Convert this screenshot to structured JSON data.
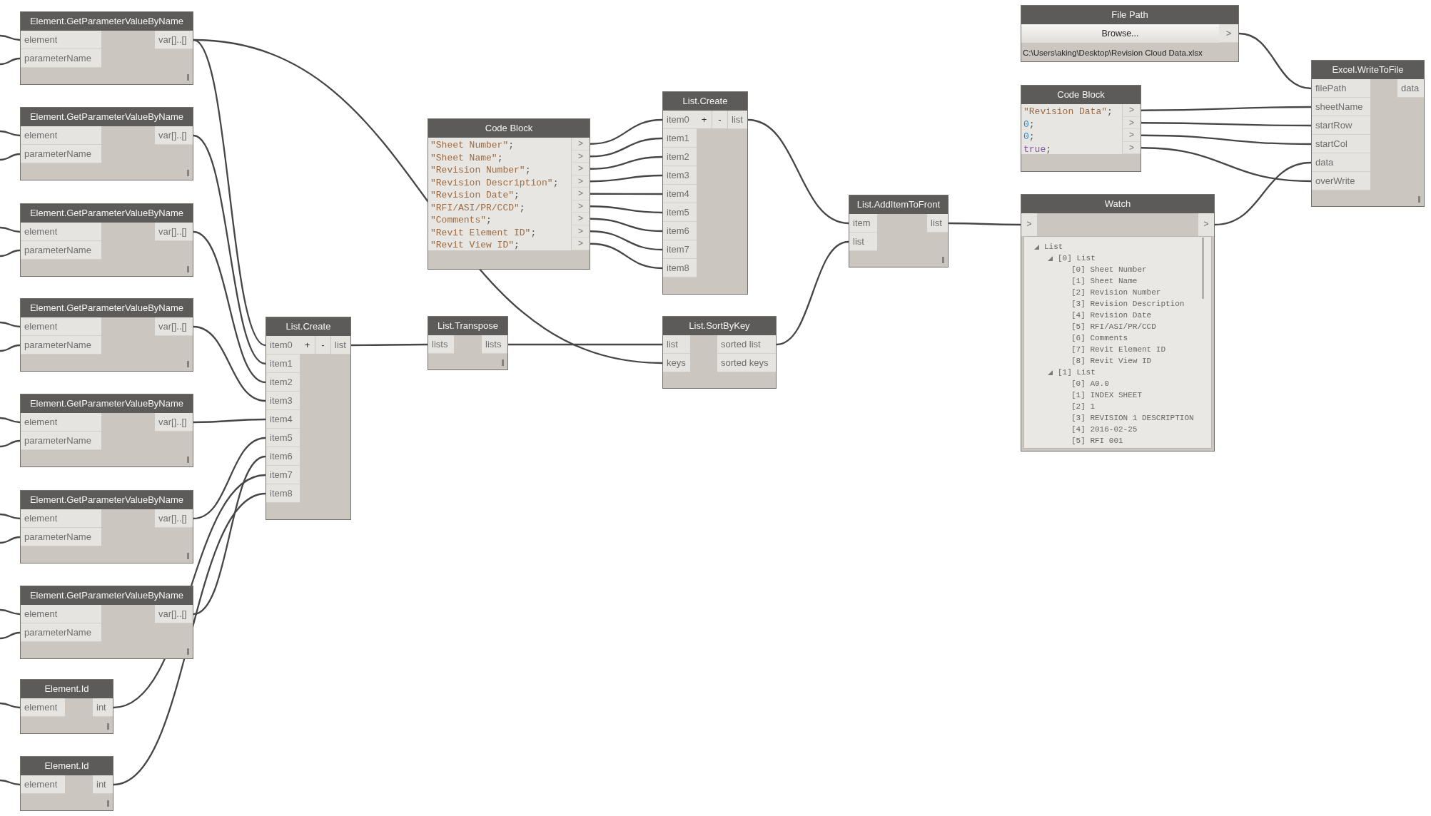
{
  "nodes": [
    {
      "kind": "function",
      "title": "Element.GetParameterValueByName",
      "inputs": [
        "element",
        "parameterName"
      ],
      "outputs": [
        "var[]..[]"
      ],
      "lacing": true
    },
    {
      "kind": "function",
      "title": "Element.GetParameterValueByName",
      "inputs": [
        "element",
        "parameterName"
      ],
      "outputs": [
        "var[]..[]"
      ],
      "lacing": true
    },
    {
      "kind": "function",
      "title": "Element.GetParameterValueByName",
      "inputs": [
        "element",
        "parameterName"
      ],
      "outputs": [
        "var[]..[]"
      ],
      "lacing": true
    },
    {
      "kind": "function",
      "title": "Element.GetParameterValueByName",
      "inputs": [
        "element",
        "parameterName"
      ],
      "outputs": [
        "var[]..[]"
      ],
      "lacing": true
    },
    {
      "kind": "function",
      "title": "Element.GetParameterValueByName",
      "inputs": [
        "element",
        "parameterName"
      ],
      "outputs": [
        "var[]..[]"
      ],
      "lacing": true
    },
    {
      "kind": "function",
      "title": "Element.GetParameterValueByName",
      "inputs": [
        "element",
        "parameterName"
      ],
      "outputs": [
        "var[]..[]"
      ],
      "lacing": true
    },
    {
      "kind": "function",
      "title": "Element.GetParameterValueByName",
      "inputs": [
        "element",
        "parameterName"
      ],
      "outputs": [
        "var[]..[]"
      ],
      "lacing": true
    },
    {
      "kind": "function",
      "title": "Element.Id",
      "inputs": [
        "element"
      ],
      "outputs": [
        "int"
      ],
      "lacing": true
    },
    {
      "kind": "function",
      "title": "Element.Id",
      "inputs": [
        "element"
      ],
      "outputs": [
        "int"
      ],
      "lacing": true
    },
    {
      "kind": "function",
      "title": "List.Create",
      "inputs": [
        "item0",
        "item1",
        "item2",
        "item3",
        "item4",
        "item5",
        "item6",
        "item7",
        "item8"
      ],
      "controls": [
        "+",
        "-"
      ],
      "outputs": [
        "list"
      ],
      "lacing": false
    },
    {
      "kind": "code_block",
      "title": "Code Block",
      "lines": [
        {
          "text": "\"Sheet Number\"",
          "kind": "string",
          "end": ";",
          "output": ">"
        },
        {
          "text": "\"Sheet Name\"",
          "kind": "string",
          "end": ";",
          "output": ">"
        },
        {
          "text": "\"Revision Number\"",
          "kind": "string",
          "end": ";",
          "output": ">"
        },
        {
          "text": "\"Revision Description\"",
          "kind": "string",
          "end": ";",
          "output": ">"
        },
        {
          "text": "\"Revision Date\"",
          "kind": "string",
          "end": ";",
          "output": ">"
        },
        {
          "text": "\"RFI/ASI/PR/CCD\"",
          "kind": "string",
          "end": ";",
          "output": ">"
        },
        {
          "text": "\"Comments\"",
          "kind": "string",
          "end": ";",
          "output": ">"
        },
        {
          "text": "\"Revit Element ID\"",
          "kind": "string",
          "end": ";",
          "output": ">"
        },
        {
          "text": "\"Revit View ID\"",
          "kind": "string",
          "end": ";",
          "output": ">"
        }
      ]
    },
    {
      "kind": "function",
      "title": "List.Transpose",
      "inputs": [
        "lists"
      ],
      "outputs": [
        "lists"
      ],
      "lacing": true
    },
    {
      "kind": "function",
      "title": "List.Create",
      "inputs": [
        "item0",
        "item1",
        "item2",
        "item3",
        "item4",
        "item5",
        "item6",
        "item7",
        "item8"
      ],
      "controls": [
        "+",
        "-"
      ],
      "outputs": [
        "list"
      ],
      "lacing": false
    },
    {
      "kind": "function",
      "title": "List.SortByKey",
      "inputs": [
        "list",
        "keys"
      ],
      "outputs": [
        "sorted list",
        "sorted keys"
      ],
      "lacing": false
    },
    {
      "kind": "function",
      "title": "List.AddItemToFront",
      "inputs": [
        "item",
        "list"
      ],
      "outputs": [
        "list"
      ],
      "lacing": true
    },
    {
      "kind": "file_path",
      "title": "File Path",
      "button": "Browse...",
      "output": ">",
      "value": "C:\\Users\\aking\\Desktop\\Revision Cloud Data.xlsx"
    },
    {
      "kind": "code_block",
      "title": "Code Block",
      "lines": [
        {
          "text": "\"Revision Data\"",
          "kind": "string",
          "end": ";",
          "output": ">"
        },
        {
          "text": "0",
          "kind": "number",
          "end": ";",
          "output": ">"
        },
        {
          "text": "0",
          "kind": "number",
          "end": ";",
          "output": ">"
        },
        {
          "text": "true",
          "kind": "boolean",
          "end": ";",
          "output": ">"
        }
      ]
    },
    {
      "kind": "watch",
      "title": "Watch",
      "input": ">",
      "output": ">",
      "tree": [
        {
          "label": "List",
          "expanded": true,
          "children": [
            {
              "label": "[0] List",
              "expanded": true,
              "children": [
                {
                  "label": "[0] Sheet Number"
                },
                {
                  "label": "[1] Sheet Name"
                },
                {
                  "label": "[2] Revision Number"
                },
                {
                  "label": "[3] Revision Description"
                },
                {
                  "label": "[4] Revision Date"
                },
                {
                  "label": "[5] RFI/ASI/PR/CCD"
                },
                {
                  "label": "[6] Comments"
                },
                {
                  "label": "[7] Revit Element ID"
                },
                {
                  "label": "[8] Revit View ID"
                }
              ]
            },
            {
              "label": "[1] List",
              "expanded": true,
              "children": [
                {
                  "label": "[0] A0.0"
                },
                {
                  "label": "[1] INDEX SHEET"
                },
                {
                  "label": "[2] 1"
                },
                {
                  "label": "[3] REVISION 1 DESCRIPTION"
                },
                {
                  "label": "[4] 2016-02-25"
                },
                {
                  "label": "[5] RFI 001"
                }
              ]
            }
          ]
        }
      ]
    },
    {
      "kind": "function",
      "title": "Excel.WriteToFile",
      "inputs": [
        "filePath",
        "sheetName",
        "startRow",
        "startCol",
        "data",
        "overWrite"
      ],
      "outputs": [
        "data"
      ],
      "lacing": true
    }
  ]
}
